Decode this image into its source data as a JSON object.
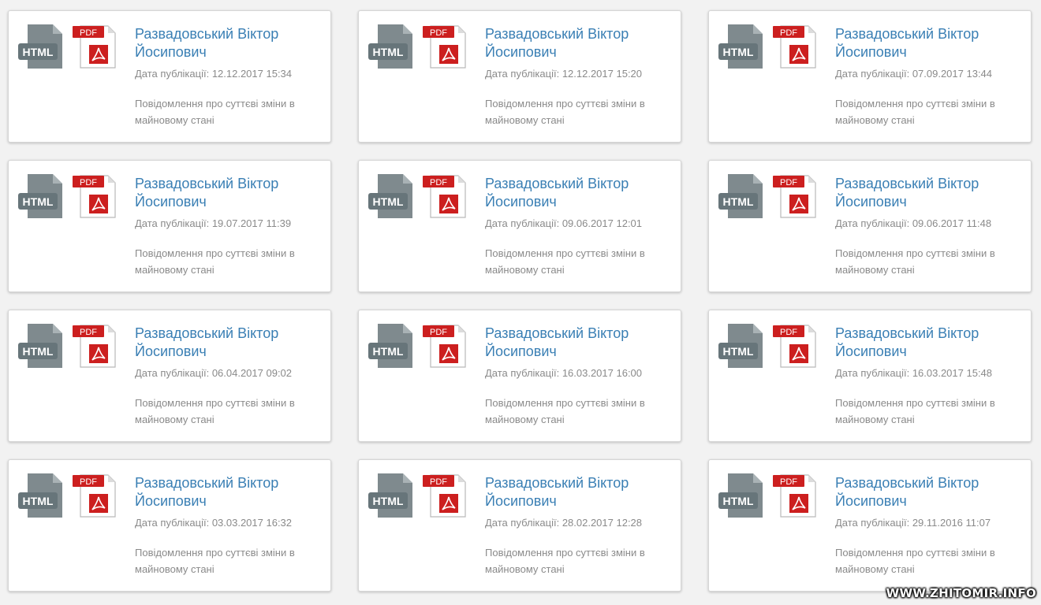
{
  "icons": {
    "html_label": "HTML",
    "pdf_label": "PDF",
    "html_color": "#7f8a8e",
    "pdf_color": "#cc1f1f"
  },
  "documents": [
    {
      "name": "Развадовський Віктор Йосипович",
      "date_label": "Дата публікації:",
      "date": "12.12.2017 15:34",
      "description": "Повідомлення про суттєві зміни в майновому стані"
    },
    {
      "name": "Развадовський Віктор Йосипович",
      "date_label": "Дата публікації:",
      "date": "12.12.2017 15:20",
      "description": "Повідомлення про суттєві зміни в майновому стані"
    },
    {
      "name": "Развадовський Віктор Йосипович",
      "date_label": "Дата публікації:",
      "date": "07.09.2017 13:44",
      "description": "Повідомлення про суттєві зміни в майновому стані"
    },
    {
      "name": "Развадовський Віктор Йосипович",
      "date_label": "Дата публікації:",
      "date": "19.07.2017 11:39",
      "description": "Повідомлення про суттєві зміни в майновому стані"
    },
    {
      "name": "Развадовський Віктор Йосипович",
      "date_label": "Дата публікації:",
      "date": "09.06.2017 12:01",
      "description": "Повідомлення про суттєві зміни в майновому стані"
    },
    {
      "name": "Развадовський Віктор Йосипович",
      "date_label": "Дата публікації:",
      "date": "09.06.2017 11:48",
      "description": "Повідомлення про суттєві зміни в майновому стані"
    },
    {
      "name": "Развадовський Віктор Йосипович",
      "date_label": "Дата публікації:",
      "date": "06.04.2017 09:02",
      "description": "Повідомлення про суттєві зміни в майновому стані"
    },
    {
      "name": "Развадовський Віктор Йосипович",
      "date_label": "Дата публікації:",
      "date": "16.03.2017 16:00",
      "description": "Повідомлення про суттєві зміни в майновому стані"
    },
    {
      "name": "Развадовський Віктор Йосипович",
      "date_label": "Дата публікації:",
      "date": "16.03.2017 15:48",
      "description": "Повідомлення про суттєві зміни в майновому стані"
    },
    {
      "name": "Развадовський Віктор Йосипович",
      "date_label": "Дата публікації:",
      "date": "03.03.2017 16:32",
      "description": "Повідомлення про суттєві зміни в майновому стані"
    },
    {
      "name": "Развадовський Віктор Йосипович",
      "date_label": "Дата публікації:",
      "date": "28.02.2017 12:28",
      "description": "Повідомлення про суттєві зміни в майновому стані"
    },
    {
      "name": "Развадовський Віктор Йосипович",
      "date_label": "Дата публікації:",
      "date": "29.11.2016 11:07",
      "description": "Повідомлення про суттєві зміни в майновому стані"
    }
  ],
  "watermark": "WWW.ZHITOMIR.INFO"
}
